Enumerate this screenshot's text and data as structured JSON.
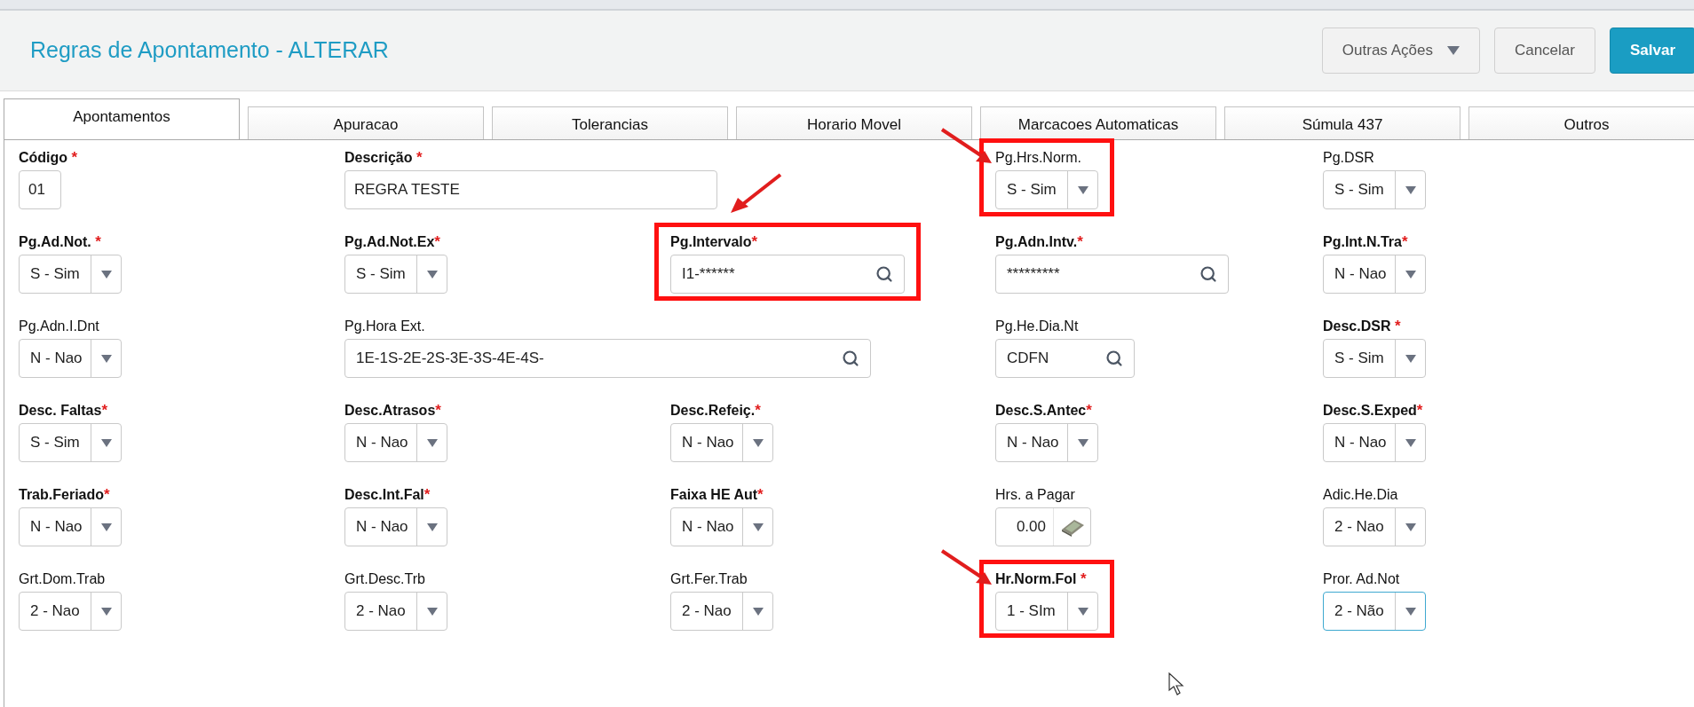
{
  "header": {
    "title": "Regras de Apontamento - ALTERAR",
    "buttons": [
      {
        "label": "Outras Ações",
        "kind": "menu"
      },
      {
        "label": "Cancelar",
        "kind": "default"
      },
      {
        "label": "Salvar",
        "kind": "primary"
      }
    ]
  },
  "tabs": [
    {
      "label": "Apontamentos",
      "selected": true
    },
    {
      "label": "Apuracao",
      "selected": false
    },
    {
      "label": "Tolerancias",
      "selected": false
    },
    {
      "label": "Horario Movel",
      "selected": false
    },
    {
      "label": "Marcacoes Automaticas",
      "selected": false
    },
    {
      "label": "Súmula 437",
      "selected": false
    },
    {
      "label": "Outros",
      "selected": false
    }
  ],
  "rows": [
    [
      {
        "label": "Código ",
        "required_mark": "*",
        "kind": "text",
        "value": "01"
      },
      {
        "label": "Descrição ",
        "required_mark": "*",
        "kind": "text",
        "value": "REGRA TESTE"
      },
      null,
      {
        "label": "Pg.Hrs.Norm.",
        "kind": "select",
        "value": "S - Sim",
        "highlighted": true,
        "arrow_from_right": false
      },
      {
        "label": "Pg.DSR",
        "kind": "select",
        "value": "S - Sim"
      }
    ],
    [
      {
        "label": "Pg.Ad.Not. ",
        "required_mark": "*",
        "kind": "select",
        "value": "S - Sim"
      },
      {
        "label": "Pg.Ad.Not.Ex",
        "required_mark": "*",
        "kind": "select",
        "value": "S - Sim"
      },
      {
        "label": "Pg.Intervalo",
        "required_mark": "*",
        "kind": "lookup",
        "value": "I1-******",
        "highlighted": true,
        "arrow_from_right": true
      },
      {
        "label": "Pg.Adn.Intv.",
        "required_mark": "*",
        "kind": "lookup",
        "value": "*********"
      },
      {
        "label": "Pg.Int.N.Tra",
        "required_mark": "*",
        "kind": "select",
        "value": "N - Nao"
      }
    ],
    [
      {
        "label": "Pg.Adn.I.Dnt",
        "kind": "select",
        "value": "N - Nao"
      },
      {
        "label": "Pg.Hora Ext.",
        "kind": "lookup",
        "value": "1E-1S-2E-2S-3E-3S-4E-4S-"
      },
      null,
      {
        "label": "Pg.He.Dia.Nt",
        "kind": "lookup",
        "value": "CDFN"
      },
      {
        "label": "Desc.DSR ",
        "required_mark": "*",
        "kind": "select",
        "value": "S - Sim"
      }
    ],
    [
      {
        "label": "Desc. Faltas",
        "required_mark": "*",
        "kind": "select",
        "value": "S - Sim"
      },
      {
        "label": "Desc.Atrasos",
        "required_mark": "*",
        "kind": "select",
        "value": "N - Nao"
      },
      {
        "label": "Desc.Refeiç.",
        "required_mark": "*",
        "kind": "select",
        "value": "N - Nao"
      },
      {
        "label": "Desc.S.Antec",
        "required_mark": "*",
        "kind": "select",
        "value": "N - Nao"
      },
      {
        "label": "Desc.S.Exped",
        "required_mark": "*",
        "kind": "select",
        "value": "N - Nao"
      }
    ],
    [
      {
        "label": "Trab.Feriado",
        "required_mark": "*",
        "kind": "select",
        "value": "N - Nao"
      },
      {
        "label": "Desc.Int.Fal",
        "required_mark": "*",
        "kind": "select",
        "value": "N - Nao"
      },
      {
        "label": "Faixa HE Aut",
        "required_mark": "*",
        "kind": "select",
        "value": "N - Nao"
      },
      {
        "label": "Hrs. a Pagar",
        "kind": "number",
        "value": "0.00"
      },
      {
        "label": "Adic.He.Dia",
        "kind": "select",
        "value": "2 - Nao"
      }
    ],
    [
      {
        "label": "Grt.Dom.Trab",
        "kind": "select",
        "value": "2 - Nao"
      },
      {
        "label": "Grt.Desc.Trb",
        "kind": "select",
        "value": "2 - Nao"
      },
      {
        "label": "Grt.Fer.Trab",
        "kind": "select",
        "value": "2 - Nao"
      },
      {
        "label": "Hr.Norm.Fol ",
        "required_mark": "*",
        "kind": "select",
        "value": "1 - SIm",
        "highlighted": true,
        "arrow_from_right": false
      },
      {
        "label": "Pror. Ad.Not",
        "kind": "select",
        "value": "2 - Não",
        "focused": true
      }
    ]
  ]
}
